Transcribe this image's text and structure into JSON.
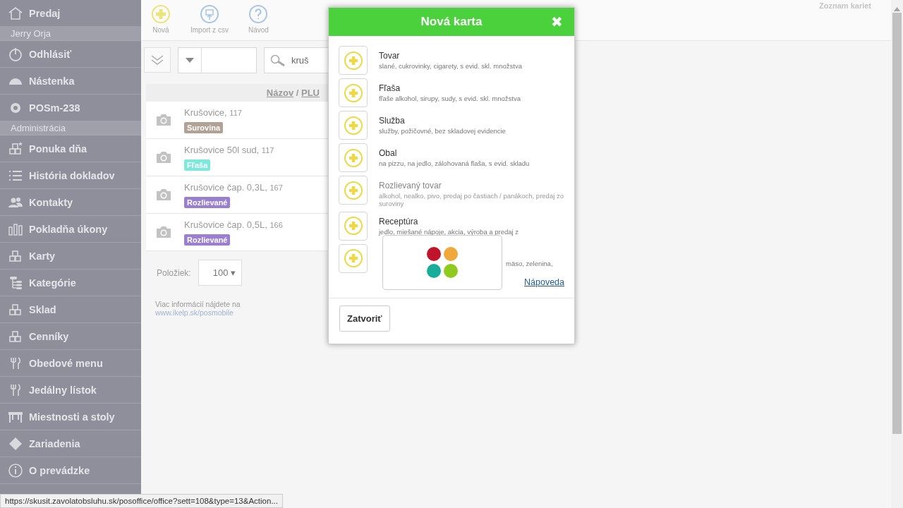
{
  "sidebar": {
    "items": [
      {
        "kind": "item",
        "label": "Predaj"
      },
      {
        "kind": "section",
        "label": "Jerry Orja"
      },
      {
        "kind": "item",
        "label": "Odhlásiť"
      },
      {
        "kind": "item",
        "label": "Nástenka"
      },
      {
        "kind": "item",
        "label": "POSm-238"
      },
      {
        "kind": "section",
        "label": "Administrácia"
      },
      {
        "kind": "item",
        "label": "Ponuka dňa"
      },
      {
        "kind": "item",
        "label": "História dokladov"
      },
      {
        "kind": "item",
        "label": "Kontakty"
      },
      {
        "kind": "item",
        "label": "Pokladňa úkony"
      },
      {
        "kind": "item",
        "label": "Karty"
      },
      {
        "kind": "item",
        "label": "Kategórie"
      },
      {
        "kind": "item",
        "label": "Sklad"
      },
      {
        "kind": "item",
        "label": "Cenníky"
      },
      {
        "kind": "item",
        "label": "Obedové menu"
      },
      {
        "kind": "item",
        "label": "Jedálny lístok"
      },
      {
        "kind": "item",
        "label": "Miestnosti a stoly"
      },
      {
        "kind": "item",
        "label": "Zariadenia"
      },
      {
        "kind": "item",
        "label": "O prevádzke"
      }
    ]
  },
  "toolbar": {
    "buttons": [
      {
        "label": "Nová"
      },
      {
        "label": "Import z csv"
      },
      {
        "label": "Návod"
      }
    ]
  },
  "page_title": "Zoznam kariet",
  "filter": {
    "search_value": "kruš"
  },
  "table": {
    "header": {
      "name": "Názov",
      "separator": "/",
      "plu": "PLU"
    },
    "rows": [
      {
        "name": "Krušovice,",
        "plu": "117",
        "tag": "Surovina",
        "color": "#b1a295"
      },
      {
        "name": "Krušovice 50l sud,",
        "plu": "117",
        "tag": "Fľaša",
        "color": "#7ee8dc"
      },
      {
        "name": "Krušovice čap. 0,3L,",
        "plu": "167",
        "tag": "Rozlievané",
        "color": "#9a7fd1"
      },
      {
        "name": "Krušovice čap. 0,5L,",
        "plu": "166",
        "tag": "Rozlievané",
        "color": "#9a7fd1"
      }
    ]
  },
  "pager": {
    "label": "Položiek:",
    "value": "100",
    "caret": "▾"
  },
  "info": {
    "text": "Viac informácií nájdete na",
    "link": "www.ikelp.sk/posmobile"
  },
  "dialog": {
    "title": "Nová karta",
    "close": "✖",
    "options": [
      {
        "title": "Tovar",
        "description": "slané, cukrovinky, cigarety, s evid. skl. množstva",
        "hover": false
      },
      {
        "title": "Fľaša",
        "description": "fľaše alkohol, sirupy, sudy, s evid. skl. množstva",
        "hover": false
      },
      {
        "title": "Služba",
        "description": "služby, požičovné, bez skladovej evidencie",
        "hover": false
      },
      {
        "title": "Obal",
        "description": "na pizzu, na jedlo, zálohovaná flaša, s evid. skladu",
        "hover": false
      },
      {
        "title": "Rozlievaný tovar",
        "description": "alkohol, nealko, pivo, predaj po častiach / panákoch, predaj zo suroviny",
        "hover": true
      },
      {
        "title": "Receptúra",
        "description": "jedlo, miešané nápoje, akcia, výroba a predaj z",
        "hover": false
      },
      {
        "description": "mäso, zelenina,",
        "hover": false
      }
    ],
    "help_link": "Nápoveda",
    "close_button": "Zatvoriť"
  },
  "status_bar": {
    "url": "https://skusit.zavolatobsluhu.sk/posoffice/office?sett=108&type=13&Action..."
  }
}
